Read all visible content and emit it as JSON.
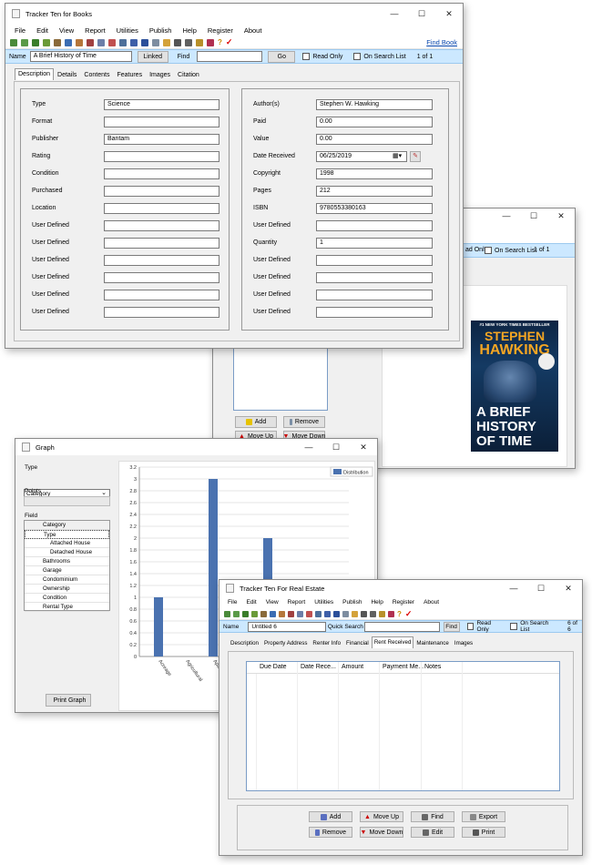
{
  "books": {
    "title": "Tracker Ten for Books",
    "window_controls": [
      "—",
      "☐",
      "✕"
    ],
    "menu": [
      "File",
      "Edit",
      "View",
      "Report",
      "Utilities",
      "Publish",
      "Help",
      "Register",
      "About"
    ],
    "find_book": "Find Book",
    "name_label": "Name",
    "name_value": "A Brief History of Time",
    "linked": "Linked",
    "find_label": "Find",
    "find_value": "",
    "go": "Go",
    "read_only": "Read Only",
    "on_search_list": "On Search List",
    "record": "1 of 1",
    "tabs": [
      "Description",
      "Details",
      "Contents",
      "Features",
      "Images",
      "Citation"
    ],
    "left_fields": [
      {
        "label": "Type",
        "value": "Science"
      },
      {
        "label": "Format",
        "value": ""
      },
      {
        "label": "Publisher",
        "value": "Bantam"
      },
      {
        "label": "Rating",
        "value": ""
      },
      {
        "label": "Condition",
        "value": ""
      },
      {
        "label": "Purchased",
        "value": ""
      },
      {
        "label": "Location",
        "value": ""
      },
      {
        "label": "User Defined",
        "value": ""
      },
      {
        "label": "User Defined",
        "value": ""
      },
      {
        "label": "User Defined",
        "value": ""
      },
      {
        "label": "User Defined",
        "value": ""
      },
      {
        "label": "User Defined",
        "value": ""
      },
      {
        "label": "User Defined",
        "value": ""
      }
    ],
    "right_fields": [
      {
        "label": "Author(s)",
        "value": "Stephen W. Hawking"
      },
      {
        "label": "Paid",
        "value": "0.00"
      },
      {
        "label": "Value",
        "value": "0.00"
      },
      {
        "label": "Date Received",
        "value": "06/25/2019"
      },
      {
        "label": "Copyright",
        "value": "1998"
      },
      {
        "label": "Pages",
        "value": "212"
      },
      {
        "label": "ISBN",
        "value": "9780553380163"
      },
      {
        "label": "User Defined",
        "value": ""
      },
      {
        "label": "Quantity",
        "value": "1"
      },
      {
        "label": "User Defined",
        "value": ""
      },
      {
        "label": "User Defined",
        "value": ""
      },
      {
        "label": "User Defined",
        "value": ""
      },
      {
        "label": "User Defined",
        "value": ""
      }
    ]
  },
  "back": {
    "window_controls": [
      "—",
      "☐",
      "✕"
    ],
    "read_only": "ad Only",
    "on_search_list": "On Search List",
    "record": "1 of 1",
    "add": "Add",
    "remove": "Remove",
    "move_up": "Move Up",
    "move_down": "Move Down",
    "cover": {
      "tagline": "#1 NEW YORK TIMES BESTSELLER",
      "author_line1": "STEPHEN",
      "author_line2": "HAWKING",
      "title_line1": "A BRIEF",
      "title_line2": "HISTORY",
      "title_line3": "OF TIME"
    }
  },
  "graph": {
    "title": "Graph",
    "window_controls": [
      "—",
      "☐",
      "✕"
    ],
    "type_label": "Type",
    "type_value": "Category",
    "points_label": "Points",
    "field_label": "Field",
    "field_header": "Category",
    "field_rows": [
      "Type",
      "Attached House",
      "Detached House",
      "Bathrooms",
      "Garage",
      "Condominium",
      "Ownership",
      "Condition",
      "Rental Type"
    ],
    "print_graph": "Print Graph",
    "chart_data": {
      "type": "bar",
      "categories": [
        "Acreage",
        "Agricultural",
        "Apartment",
        "Attached House",
        "Detached House",
        "Mobile"
      ],
      "series": [
        {
          "name": "Distribution",
          "values": [
            1,
            0,
            3,
            0,
            2,
            0
          ]
        }
      ],
      "ylim": [
        0,
        3.2
      ],
      "yticks": [
        "0",
        "0.2",
        "0.4",
        "0.6",
        "0.8",
        "1",
        "1.2",
        "1.4",
        "1.6",
        "1.8",
        "2",
        "2.2",
        "2.4",
        "2.6",
        "2.8",
        "3",
        "3.2"
      ],
      "xlabels": [
        "Acreage",
        "Agricultural",
        "Apartment",
        "Attached House",
        "Detached House",
        "Mobile Hom"
      ],
      "legend": "Distribution",
      "color": "#4a72b0"
    }
  },
  "realestate": {
    "title": "Tracker Ten For Real Estate",
    "window_controls": [
      "—",
      "☐",
      "✕"
    ],
    "menu": [
      "File",
      "Edit",
      "View",
      "Report",
      "Utilities",
      "Publish",
      "Help",
      "Register",
      "About"
    ],
    "name_label": "Name",
    "name_value": "Untitled 6",
    "quick_search": "Quick Search",
    "find": "Find",
    "read_only": "Read Only",
    "on_search_list": "On Search List",
    "record": "6 of 6",
    "tabs": [
      "Description",
      "Property Address",
      "Renter Info",
      "Financial",
      "Rent Received",
      "Maintenance",
      "Images"
    ],
    "columns": [
      "Due Date",
      "Date Rece...",
      "Amount",
      "Payment Me...",
      "Notes"
    ],
    "buttons": [
      "Add",
      "Move Up",
      "Find",
      "Export",
      "Remove",
      "Move Down",
      "Edit",
      "Print"
    ]
  }
}
